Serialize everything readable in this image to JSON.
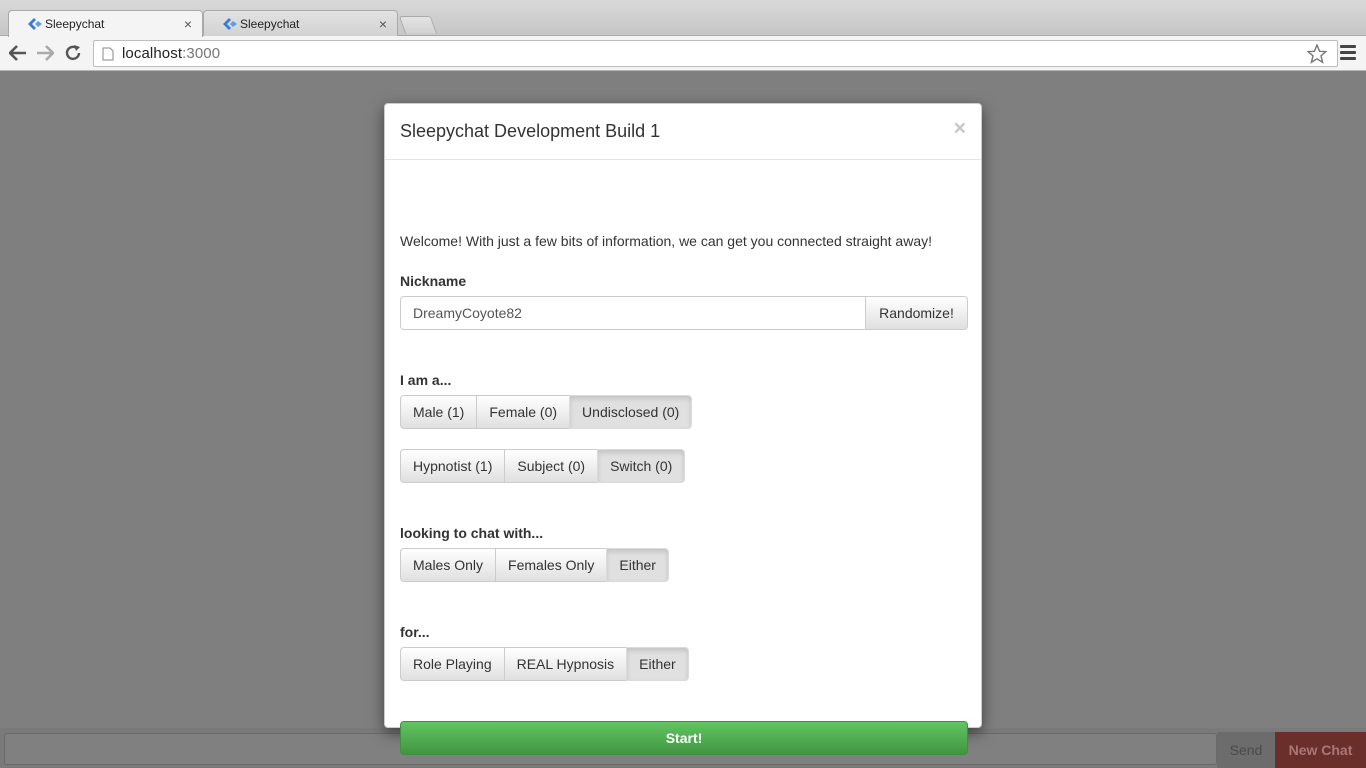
{
  "browser": {
    "tabs": [
      {
        "title": "Sleepychat",
        "active": true
      },
      {
        "title": "Sleepychat",
        "active": false
      }
    ],
    "tab_close_glyph": "×",
    "url_host": "localhost",
    "url_port": ":3000"
  },
  "modal": {
    "title": "Sleepychat Development Build 1",
    "close_glyph": "×",
    "welcome": "Welcome! With just a few bits of information, we can get you connected straight away!",
    "nickname_label": "Nickname",
    "nickname_value": "DreamyCoyote82",
    "randomize_label": "Randomize!",
    "gender_label": "I am a...",
    "gender_options": [
      "Male (1)",
      "Female (0)",
      "Undisclosed (0)"
    ],
    "gender_selected": "Undisclosed (0)",
    "role_options": [
      "Hypnotist (1)",
      "Subject (0)",
      "Switch (0)"
    ],
    "role_selected": "Switch (0)",
    "chatwith_label": "looking to chat with...",
    "chatwith_options": [
      "Males Only",
      "Females Only",
      "Either"
    ],
    "chatwith_selected": "Either",
    "for_label": "for...",
    "for_options": [
      "Role Playing",
      "REAL Hypnosis",
      "Either"
    ],
    "for_selected": "Either",
    "start_label": "Start!"
  },
  "chatbar": {
    "send_label": "Send",
    "new_chat_label": "New Chat"
  },
  "colors": {
    "start_green": "#5cb85c",
    "new_chat_red": "#6a2e2b",
    "backdrop": "#7f7f7f"
  }
}
